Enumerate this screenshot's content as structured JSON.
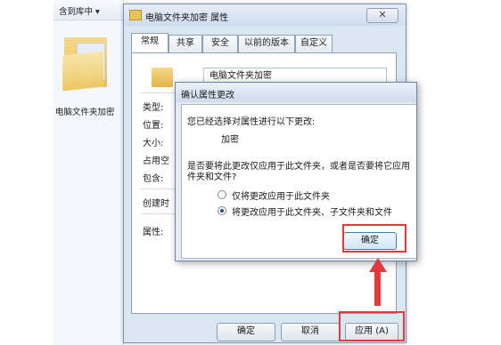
{
  "explorer": {
    "toolbar_label": "含到库中 ▾",
    "folder_name": "电脑文件夹加密"
  },
  "properties": {
    "title": "电脑文件夹加密 属性",
    "close_glyph": "✕",
    "tabs": [
      "常规",
      "共享",
      "安全",
      "以前的版本",
      "自定义"
    ],
    "folder_name_value": "电脑文件夹加密",
    "field_labels": [
      "类型:",
      "位置:",
      "大小:",
      "占用空",
      "包含:",
      "创建时",
      "属性:"
    ],
    "buttons": {
      "ok": "确定",
      "cancel": "取消",
      "apply": "应用 (A)"
    }
  },
  "dialog": {
    "title": "确认属性更改",
    "line1": "您已经选择对属性进行以下更改:",
    "change": "加密",
    "question_l1": "是否要将此更改仅应用于此文件夹，或者是否要将它应用",
    "question_l2": "件夹和文件?",
    "option1": "仅将更改应用于此文件夹",
    "option2": "将更改应用于此文件夹、子文件夹和文件",
    "selected_option": 2,
    "ok": "确定"
  },
  "colors": {
    "highlight": "#e23a3a",
    "accent": "#3c7fb1"
  }
}
